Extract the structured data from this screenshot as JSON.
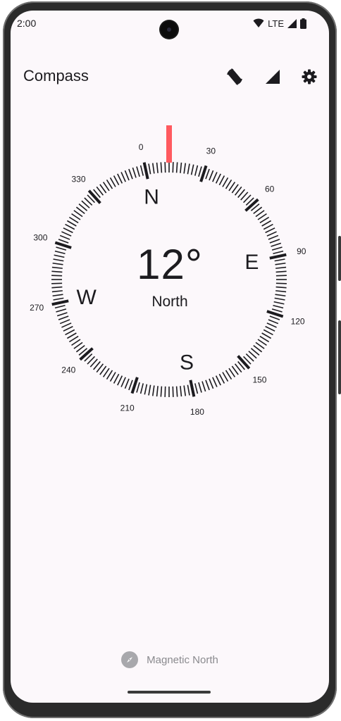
{
  "status_bar": {
    "time": "2:00",
    "network": "LTE"
  },
  "app": {
    "title": "Compass"
  },
  "toolbar": {
    "icons": [
      "screen-rotation-icon",
      "signal-icon",
      "settings-icon"
    ]
  },
  "compass": {
    "heading_deg": 12,
    "heading_text": "12°",
    "direction": "North",
    "cardinals": {
      "n": "N",
      "e": "E",
      "s": "S",
      "w": "W"
    },
    "degree_labels": [
      "0",
      "30",
      "60",
      "90",
      "120",
      "150",
      "180",
      "210",
      "240",
      "270",
      "300",
      "330"
    ],
    "indicator_color": "#ff5a5f"
  },
  "footer": {
    "label": "Magnetic North",
    "icon": "compass-icon"
  }
}
